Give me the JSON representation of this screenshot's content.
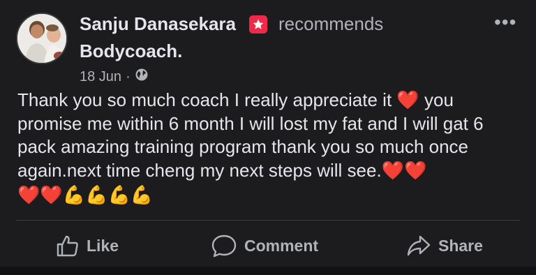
{
  "post": {
    "author": "Sanju Danasekara",
    "action": "recommends",
    "page": "Bodycoach.",
    "date": "18 Jun",
    "separator": "·",
    "audience_icon": "globe-icon",
    "more_icon": "more-options-icon",
    "text": "Thank you so much  coach  I really appreciate it ❤️ you promise me within 6 month I will lost my fat and I will gat 6 pack amazing training program thank you so much once again.next time cheng my next steps will see.❤️❤️",
    "emoji_line": "❤️❤️💪💪💪💪"
  },
  "actions": {
    "like": "Like",
    "comment": "Comment",
    "share": "Share"
  },
  "colors": {
    "background": "#1c1c1e",
    "text_primary": "#e4e6eb",
    "text_secondary": "#b0b3b8",
    "badge": "#f02849"
  }
}
